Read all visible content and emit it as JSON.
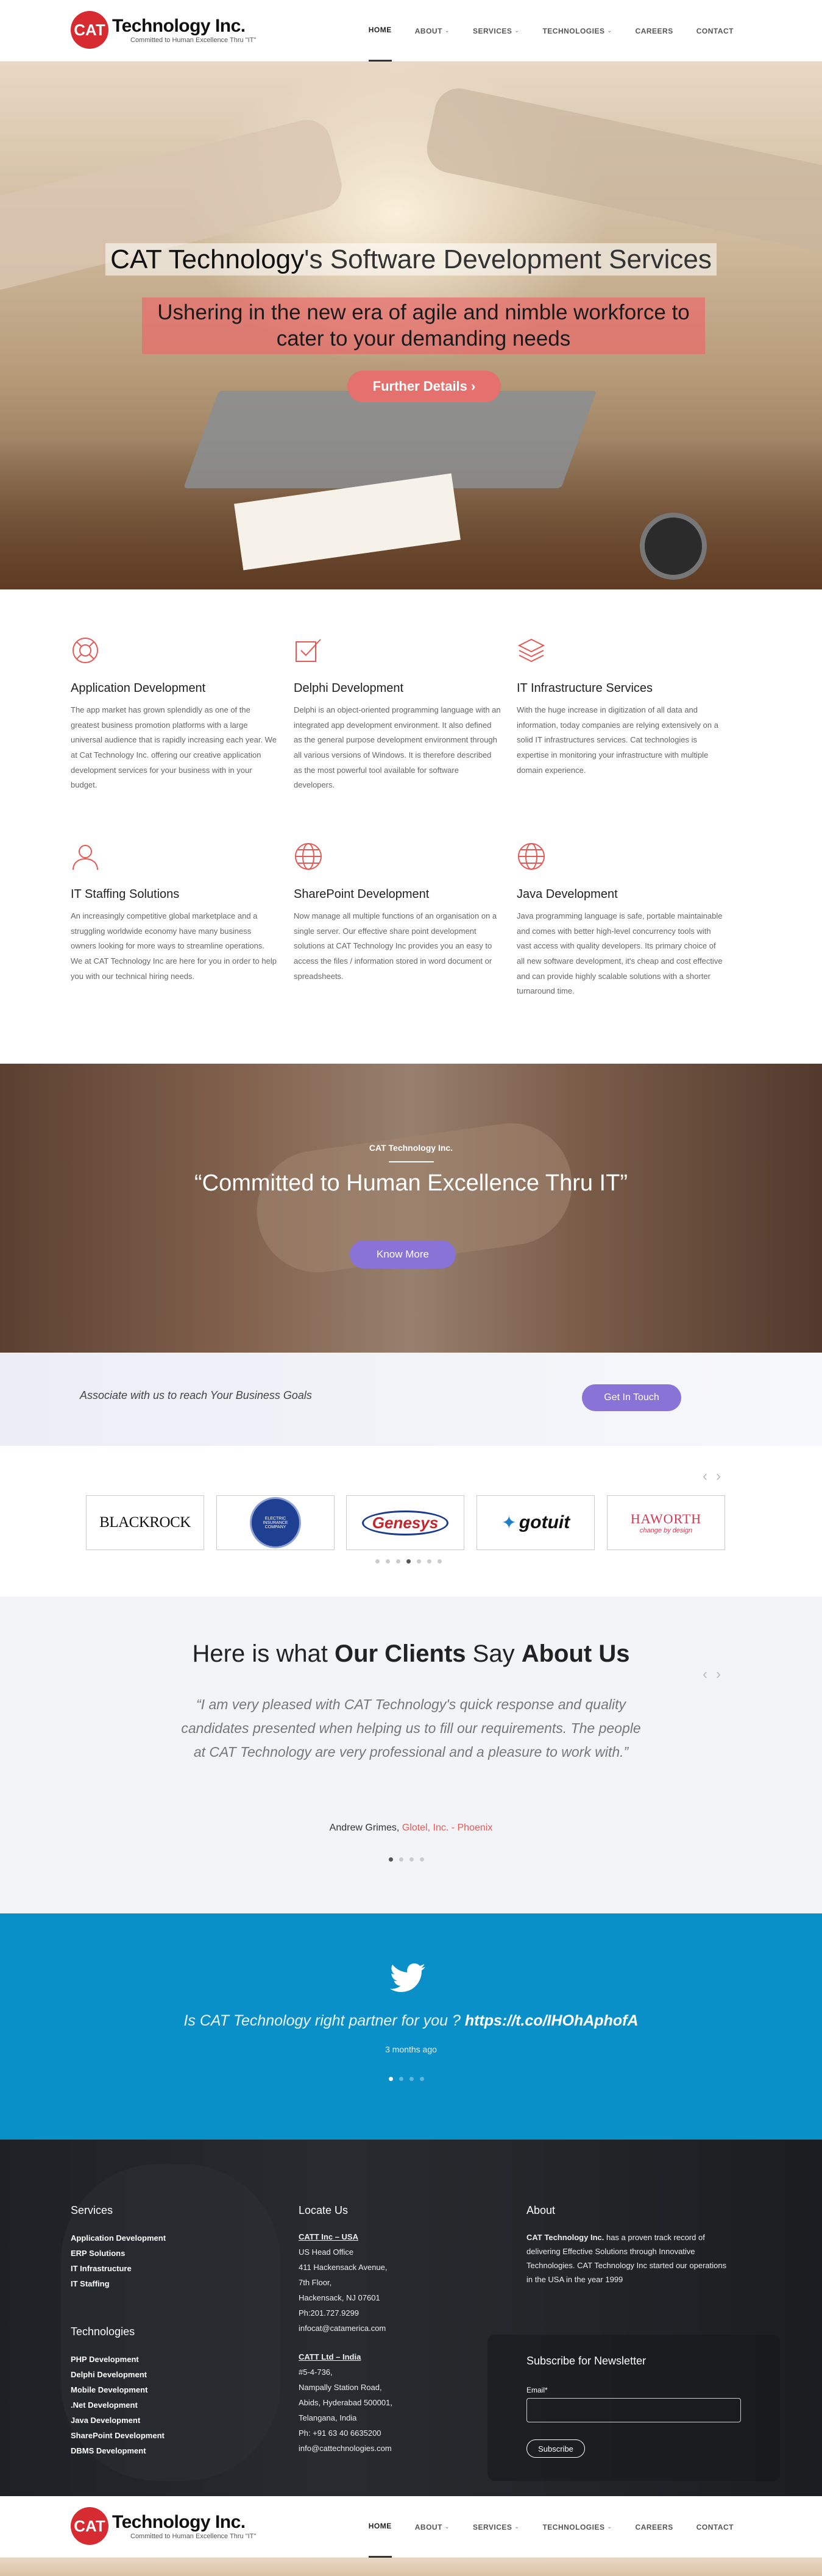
{
  "header": {
    "logo_mark": "CAT",
    "logo_name": "Technology Inc.",
    "logo_tagline": "Committed to Human Excellence Thru \"IT\"",
    "nav": [
      "HOME",
      "ABOUT",
      "SERVICES",
      "TECHNOLOGIES",
      "CAREERS",
      "CONTACT"
    ]
  },
  "hero": {
    "title_brand": "CAT Technology",
    "title_rest": "'s Software Development Services",
    "subtitle": "Ushering in the new era of agile and nimble workforce to cater to your demanding needs",
    "button": "Further Details"
  },
  "services": [
    {
      "icon": "lifebuoy-icon",
      "title": "Application Development",
      "text": "The app market has grown splendidly as one of the greatest business promotion platforms with a large universal audience that is rapidly increasing each year. We at Cat Technology Inc. offering our creative application development services for your business with in your budget."
    },
    {
      "icon": "checkbox-edit-icon",
      "title": "Delphi Development",
      "text": "Delphi is an object-oriented programming language with an integrated app development environment. It also defined as the general purpose development environment through all various versions of Windows. It is therefore described as the most powerful tool available for software developers."
    },
    {
      "icon": "layers-icon",
      "title": "IT Infrastructure Services",
      "text": "With the huge increase in digitization of all data and information, today companies are relying extensively on a solid IT infrastructures services. Cat technologies is expertise in monitoring your infrastructure with multiple domain experience."
    },
    {
      "icon": "user-icon",
      "title": "IT Staffing Solutions",
      "text": "An increasingly competitive global marketplace and a struggling worldwide economy have many business owners looking for more ways to streamline operations. We at CAT Technology Inc are here for you in order to help you with our technical hiring needs."
    },
    {
      "icon": "globe-icon",
      "title": "SharePoint Development",
      "text": "Now manage all multiple functions of an organisation on a single server. Our effective share point development solutions at CAT Technology Inc provides you an easy to access the files / information stored in word document or spreadsheets."
    },
    {
      "icon": "globe-icon",
      "title": "Java Development",
      "text": "Java programming language is safe, portable maintainable and comes with better high-level concurrency tools with vast access with quality developers. Its primary choice of all new software development, it's cheap and cost effective and can provide highly scalable solutions with a shorter turnaround time."
    }
  ],
  "band": {
    "small": "CAT Technology Inc.",
    "quote": "“Committed to Human Excellence Thru IT”",
    "button": "Know More"
  },
  "associate": {
    "text": "Associate with us to reach Your Business Goals",
    "button": "Get In Touch"
  },
  "clients": {
    "logos": [
      "BLACKROCK",
      "ELECTRIC INSURANCE COMPANY",
      "Genesys",
      "gotuit",
      "HAWORTH"
    ],
    "haworth_tag": "change by design",
    "dots": 7,
    "active_dot": 3
  },
  "testimonials": {
    "heading_a": "Here is what ",
    "heading_b": "Our Clients",
    "heading_c": " Say ",
    "heading_d": "About Us",
    "quote": "“I am very pleased with CAT Technology's quick response and quality candidates presented when helping us to fill our requirements. The people at CAT Technology are very professional and a pleasure to work with.”",
    "author": "Andrew Grimes, ",
    "company": "Glotel, Inc. - Phoenix",
    "dots": 4,
    "active_dot": 0
  },
  "twitter": {
    "text": "Is CAT Technology right partner for you ? ",
    "link": "https://t.co/IHOhAphofA",
    "time": "3 months ago",
    "dots": 4,
    "active_dot": 0
  },
  "footer": {
    "services_title": "Services",
    "services": [
      "Application Development",
      "ERP Solutions",
      "IT Infrastructure",
      "IT Staffing"
    ],
    "tech_title": "Technologies",
    "tech": [
      "PHP Development",
      "Delphi Development",
      "Mobile Development",
      ".Net Development",
      "Java Development",
      "SharePoint Development",
      "DBMS Development"
    ],
    "locate_title": "Locate Us",
    "usa": [
      "CATT Inc – USA",
      "US Head Office",
      "411 Hackensack Avenue,",
      "7th Floor,",
      "Hackensack, NJ 07601",
      "Ph:201.727.9299",
      "infocat@catamerica.com"
    ],
    "india": [
      "CATT Ltd – India",
      "#5-4-736,",
      "Nampally Station Road,",
      "Abids, Hyderabad 500001,",
      "Telangana, India",
      "Ph: +91 63 40 6635200",
      "info@cattechnologies.com"
    ],
    "about_title": "About",
    "about_bold": "CAT Technology Inc.",
    "about_text": " has a proven track record of delivering Effective Solutions through Innovative Technologies. CAT Technology Inc started our operations in the USA in the year 1999",
    "nl_title": "Subscribe for Newsletter",
    "nl_label": "Email*",
    "nl_button": "Subscribe"
  },
  "colors": {
    "brand_red": "#d62b31",
    "accent_purple": "#8a73d6",
    "twitter_blue": "#0a90c8"
  }
}
